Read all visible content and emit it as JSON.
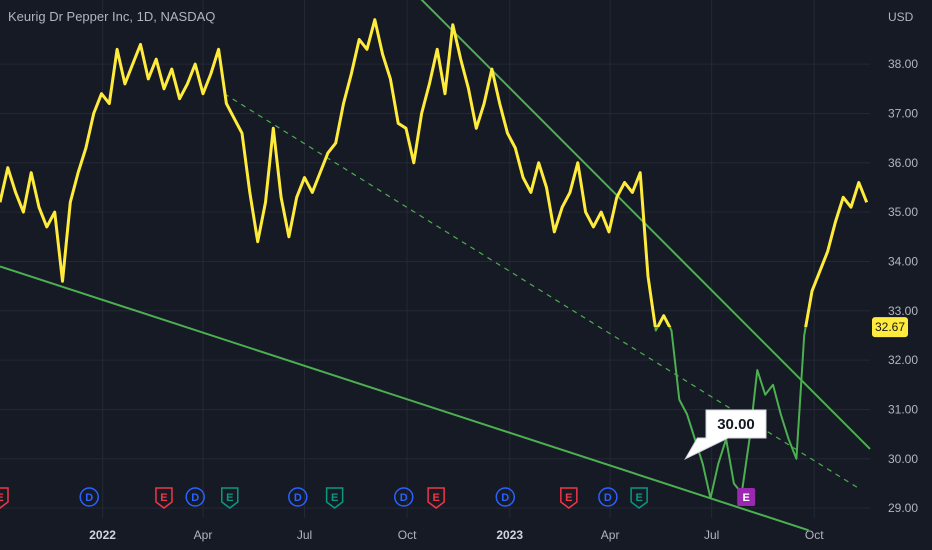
{
  "header": {
    "title": "Keurig Dr Pepper Inc, 1D, NASDAQ"
  },
  "price_axis": {
    "currency": "USD"
  },
  "colors": {
    "background": "#161a25",
    "price_up": "#ffeb3b",
    "price_low": "#4caf50",
    "trend": "#4caf50",
    "last_price_bg": "#ffeb3b",
    "earnings_marker": "#f23645",
    "dividend_marker": "#2962ff",
    "estimate_marker": "#089981",
    "upcoming_marker": "#9c27b0"
  },
  "chart_data": {
    "type": "line",
    "title": "Keurig Dr Pepper Inc, 1D, NASDAQ",
    "xlabel": "",
    "ylabel": "USD",
    "ylim": [
      28.8,
      39.3
    ],
    "y_ticks": [
      "38.00",
      "37.00",
      "36.00",
      "35.00",
      "34.00",
      "33.00",
      "32.00",
      "31.00",
      "30.00",
      "29.00"
    ],
    "x_ticks": [
      "2022",
      "Apr",
      "Jul",
      "Oct",
      "2023",
      "Apr",
      "Jul",
      "Oct"
    ],
    "x_range": [
      "2021-10-01",
      "2023-11-20"
    ],
    "last_price": "32.67",
    "annotation": {
      "label": "30.00",
      "date": "2023-06-20",
      "value": 30.0
    },
    "threshold_price": 32.67,
    "series": [
      {
        "color_above": "#ffeb3b",
        "color_below": "#4caf50",
        "points": [
          [
            "2021-10-01",
            35.2
          ],
          [
            "2021-10-08",
            35.9
          ],
          [
            "2021-10-15",
            35.4
          ],
          [
            "2021-10-22",
            35.0
          ],
          [
            "2021-10-29",
            35.8
          ],
          [
            "2021-11-05",
            35.1
          ],
          [
            "2021-11-12",
            34.7
          ],
          [
            "2021-11-19",
            35.0
          ],
          [
            "2021-11-26",
            33.6
          ],
          [
            "2021-12-03",
            35.2
          ],
          [
            "2021-12-10",
            35.8
          ],
          [
            "2021-12-17",
            36.3
          ],
          [
            "2021-12-24",
            37.0
          ],
          [
            "2021-12-31",
            37.4
          ],
          [
            "2022-01-07",
            37.2
          ],
          [
            "2022-01-14",
            38.3
          ],
          [
            "2022-01-21",
            37.6
          ],
          [
            "2022-01-28",
            38.0
          ],
          [
            "2022-02-04",
            38.4
          ],
          [
            "2022-02-11",
            37.7
          ],
          [
            "2022-02-18",
            38.1
          ],
          [
            "2022-02-25",
            37.5
          ],
          [
            "2022-03-04",
            37.9
          ],
          [
            "2022-03-11",
            37.3
          ],
          [
            "2022-03-18",
            37.6
          ],
          [
            "2022-03-25",
            38.0
          ],
          [
            "2022-04-01",
            37.4
          ],
          [
            "2022-04-08",
            37.8
          ],
          [
            "2022-04-15",
            38.3
          ],
          [
            "2022-04-22",
            37.2
          ],
          [
            "2022-04-29",
            36.9
          ],
          [
            "2022-05-06",
            36.6
          ],
          [
            "2022-05-13",
            35.4
          ],
          [
            "2022-05-20",
            34.4
          ],
          [
            "2022-05-27",
            35.2
          ],
          [
            "2022-06-03",
            36.7
          ],
          [
            "2022-06-10",
            35.3
          ],
          [
            "2022-06-17",
            34.5
          ],
          [
            "2022-06-24",
            35.3
          ],
          [
            "2022-07-01",
            35.7
          ],
          [
            "2022-07-08",
            35.4
          ],
          [
            "2022-07-15",
            35.8
          ],
          [
            "2022-07-22",
            36.2
          ],
          [
            "2022-07-29",
            36.4
          ],
          [
            "2022-08-05",
            37.2
          ],
          [
            "2022-08-12",
            37.8
          ],
          [
            "2022-08-19",
            38.5
          ],
          [
            "2022-08-26",
            38.3
          ],
          [
            "2022-09-02",
            38.9
          ],
          [
            "2022-09-09",
            38.2
          ],
          [
            "2022-09-16",
            37.7
          ],
          [
            "2022-09-23",
            36.8
          ],
          [
            "2022-09-30",
            36.7
          ],
          [
            "2022-10-07",
            36.0
          ],
          [
            "2022-10-14",
            37.0
          ],
          [
            "2022-10-21",
            37.6
          ],
          [
            "2022-10-28",
            38.3
          ],
          [
            "2022-11-04",
            37.4
          ],
          [
            "2022-11-11",
            38.8
          ],
          [
            "2022-11-18",
            38.1
          ],
          [
            "2022-11-25",
            37.5
          ],
          [
            "2022-12-02",
            36.7
          ],
          [
            "2022-12-09",
            37.2
          ],
          [
            "2022-12-16",
            37.9
          ],
          [
            "2022-12-23",
            37.2
          ],
          [
            "2022-12-30",
            36.6
          ],
          [
            "2023-01-06",
            36.3
          ],
          [
            "2023-01-13",
            35.7
          ],
          [
            "2023-01-20",
            35.4
          ],
          [
            "2023-01-27",
            36.0
          ],
          [
            "2023-02-03",
            35.5
          ],
          [
            "2023-02-10",
            34.6
          ],
          [
            "2023-02-17",
            35.1
          ],
          [
            "2023-02-24",
            35.4
          ],
          [
            "2023-03-03",
            36.0
          ],
          [
            "2023-03-10",
            35.0
          ],
          [
            "2023-03-17",
            34.7
          ],
          [
            "2023-03-24",
            35.0
          ],
          [
            "2023-03-31",
            34.6
          ],
          [
            "2023-04-07",
            35.3
          ],
          [
            "2023-04-14",
            35.6
          ],
          [
            "2023-04-21",
            35.4
          ],
          [
            "2023-04-28",
            35.8
          ],
          [
            "2023-05-05",
            33.7
          ],
          [
            "2023-05-12",
            32.6
          ],
          [
            "2023-05-19",
            32.9
          ],
          [
            "2023-05-26",
            32.6
          ],
          [
            "2023-06-02",
            31.2
          ],
          [
            "2023-06-09",
            30.9
          ],
          [
            "2023-06-16",
            30.4
          ],
          [
            "2023-06-23",
            29.9
          ],
          [
            "2023-06-30",
            29.2
          ],
          [
            "2023-07-07",
            29.9
          ],
          [
            "2023-07-14",
            30.4
          ],
          [
            "2023-07-21",
            29.5
          ],
          [
            "2023-07-28",
            29.3
          ],
          [
            "2023-08-04",
            30.4
          ],
          [
            "2023-08-11",
            31.8
          ],
          [
            "2023-08-18",
            31.3
          ],
          [
            "2023-08-25",
            31.5
          ],
          [
            "2023-09-01",
            30.9
          ],
          [
            "2023-09-08",
            30.4
          ],
          [
            "2023-09-15",
            30.0
          ],
          [
            "2023-09-22",
            32.5
          ],
          [
            "2023-09-29",
            33.4
          ],
          [
            "2023-10-06",
            33.8
          ],
          [
            "2023-10-13",
            34.2
          ],
          [
            "2023-10-20",
            34.8
          ],
          [
            "2023-10-27",
            35.3
          ],
          [
            "2023-11-03",
            35.1
          ],
          [
            "2023-11-10",
            35.6
          ],
          [
            "2023-11-17",
            35.2
          ]
        ]
      }
    ],
    "trendlines": [
      {
        "style": "solid",
        "from": [
          "2021-10-01",
          33.9
        ],
        "to": [
          "2023-09-26",
          28.55
        ]
      },
      {
        "style": "solid",
        "from": [
          "2022-10-01",
          39.6
        ],
        "to": [
          "2023-11-20",
          30.2
        ]
      },
      {
        "style": "dashed",
        "from": [
          "2022-04-20",
          37.4
        ],
        "to": [
          "2023-11-10",
          29.4
        ]
      }
    ],
    "events": [
      {
        "date": "2021-10-01",
        "label": "E",
        "kind": "earnings"
      },
      {
        "date": "2021-12-20",
        "label": "D",
        "kind": "dividend"
      },
      {
        "date": "2022-02-25",
        "label": "E",
        "kind": "earnings"
      },
      {
        "date": "2022-03-25",
        "label": "D",
        "kind": "dividend"
      },
      {
        "date": "2022-04-25",
        "label": "E",
        "kind": "estimate"
      },
      {
        "date": "2022-06-25",
        "label": "D",
        "kind": "dividend"
      },
      {
        "date": "2022-07-28",
        "label": "E",
        "kind": "estimate"
      },
      {
        "date": "2022-09-28",
        "label": "D",
        "kind": "dividend"
      },
      {
        "date": "2022-10-27",
        "label": "E",
        "kind": "earnings"
      },
      {
        "date": "2022-12-28",
        "label": "D",
        "kind": "dividend"
      },
      {
        "date": "2023-02-23",
        "label": "E",
        "kind": "earnings"
      },
      {
        "date": "2023-03-30",
        "label": "D",
        "kind": "dividend"
      },
      {
        "date": "2023-04-27",
        "label": "E",
        "kind": "estimate"
      },
      {
        "date": "2023-08-01",
        "label": "E",
        "kind": "upcoming"
      }
    ]
  }
}
